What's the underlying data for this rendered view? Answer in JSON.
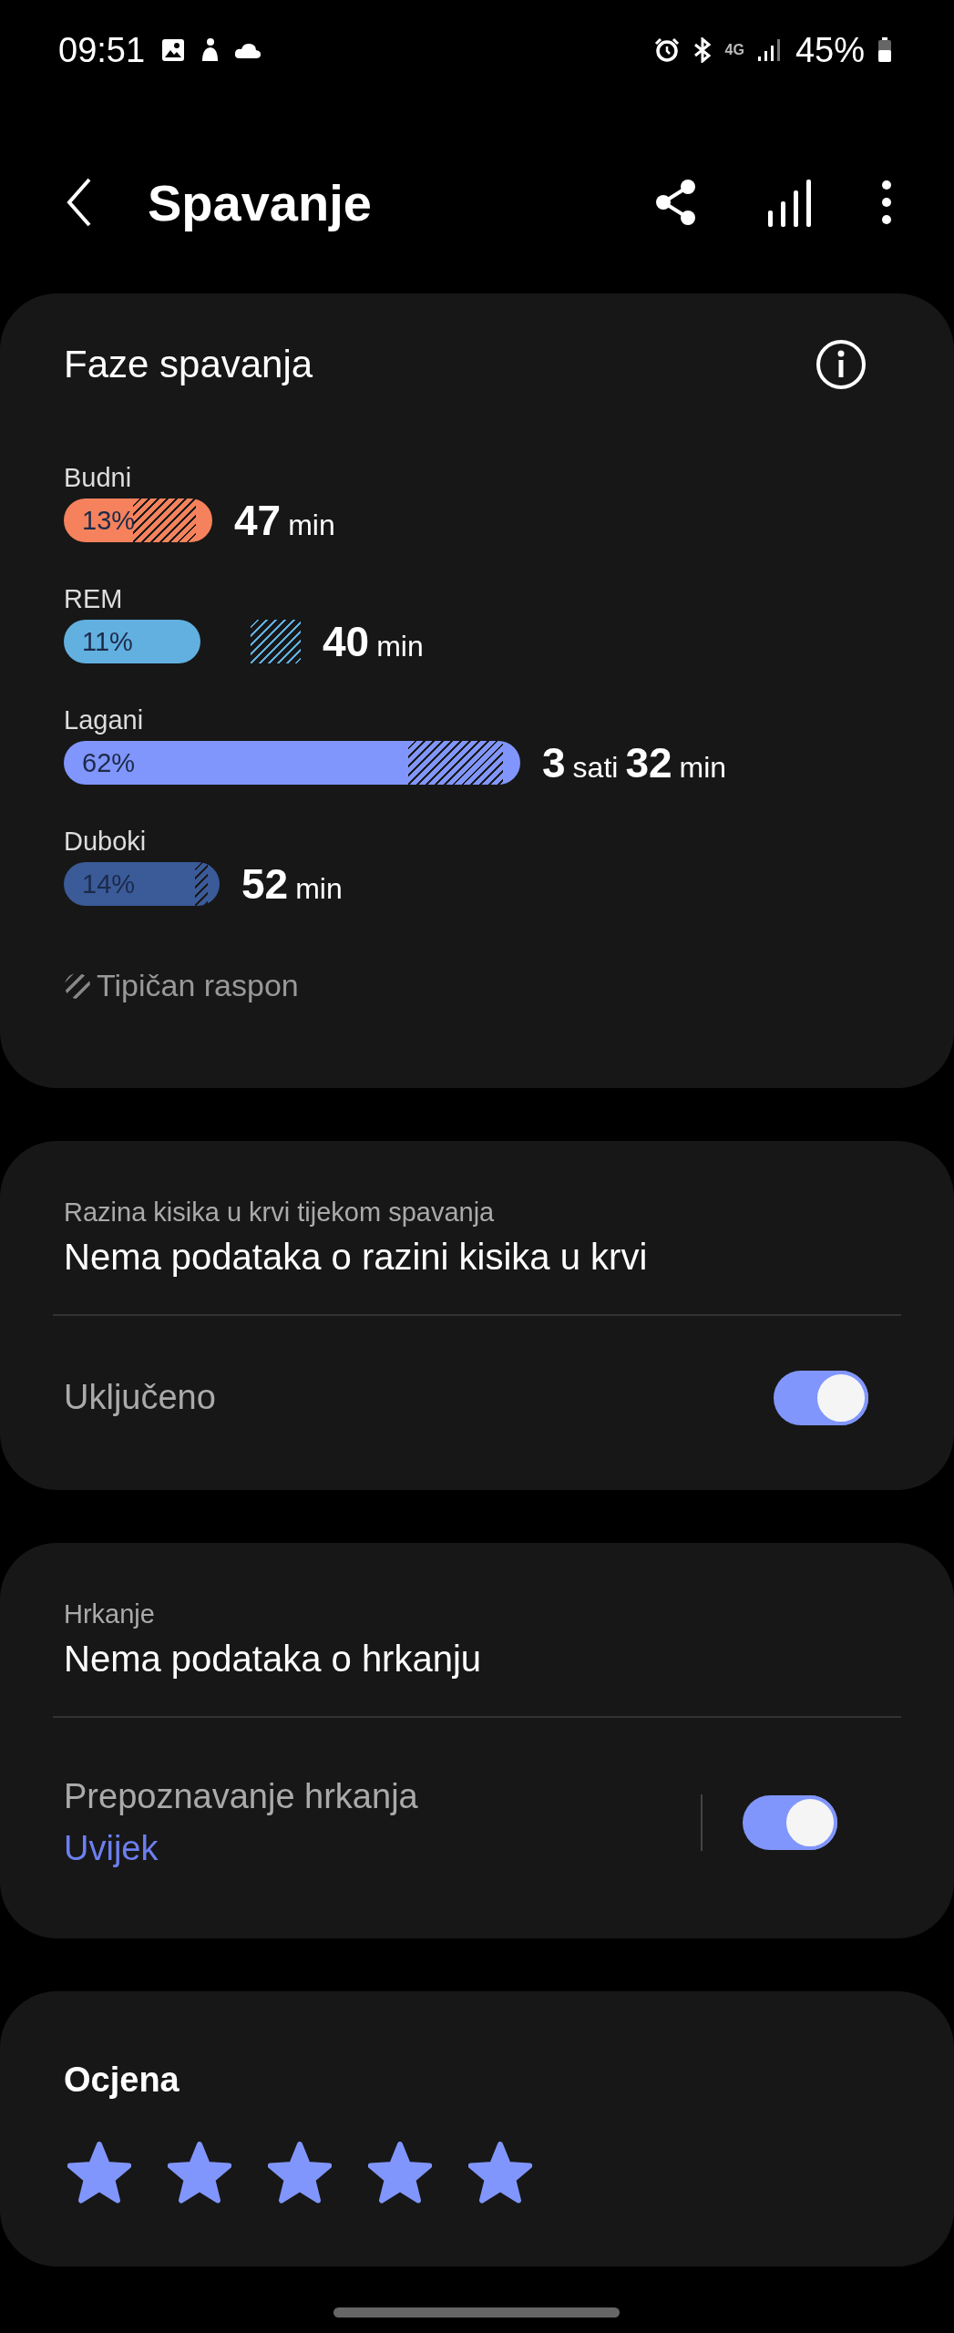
{
  "status_bar": {
    "time": "09:51",
    "network": "4G",
    "battery": "45%"
  },
  "header": {
    "title": "Spavanje"
  },
  "phases_card": {
    "title": "Faze spavanja",
    "phases": [
      {
        "label": "Budni",
        "percent": "13%",
        "color": "#f5825c",
        "duration": [
          {
            "kind": "number",
            "text": "47"
          },
          {
            "kind": "unit",
            "text": "min"
          }
        ]
      },
      {
        "label": "REM",
        "percent": "11%",
        "color": "#62b0e0",
        "duration": [
          {
            "kind": "number",
            "text": "40"
          },
          {
            "kind": "unit",
            "text": "min"
          }
        ]
      },
      {
        "label": "Lagani",
        "percent": "62%",
        "color": "#8196fc",
        "duration": [
          {
            "kind": "number",
            "text": "3"
          },
          {
            "kind": "unit",
            "text": "sati"
          },
          {
            "kind": "number",
            "text": "32"
          },
          {
            "kind": "unit",
            "text": "min"
          }
        ]
      },
      {
        "label": "Duboki",
        "percent": "14%",
        "color": "#3a5a98",
        "duration": [
          {
            "kind": "number",
            "text": "52"
          },
          {
            "kind": "unit",
            "text": "min"
          }
        ]
      }
    ],
    "legend": "Tipičan raspon"
  },
  "oxygen_card": {
    "label": "Razina kisika u krvi tijekom spavanja",
    "value": "Nema podataka o razini kisika u krvi",
    "setting": {
      "label": "Uključeno",
      "on": true
    }
  },
  "snoring_card": {
    "label": "Hrkanje",
    "value": "Nema podataka o hrkanju",
    "setting": {
      "label": "Prepoznavanje hrkanja",
      "sub": "Uvijek",
      "on": true
    }
  },
  "rating_card": {
    "title": "Ocjena",
    "stars": 5
  }
}
